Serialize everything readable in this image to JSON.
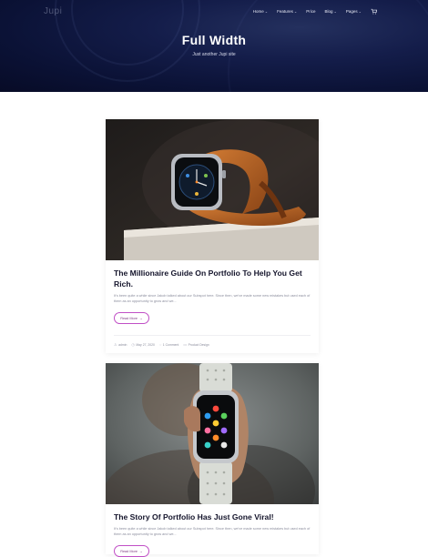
{
  "site": {
    "logo": "Jupi"
  },
  "nav": {
    "items": [
      {
        "label": "Home",
        "chevron": true
      },
      {
        "label": "Features",
        "chevron": true
      },
      {
        "label": "Price",
        "chevron": false
      },
      {
        "label": "Blog",
        "chevron": true
      },
      {
        "label": "Pages",
        "chevron": true
      }
    ],
    "cart_icon": "cart-icon"
  },
  "hero": {
    "title": "Full Width",
    "subtitle": "Just another Jupi site"
  },
  "posts": [
    {
      "title": "The Millionaire Guide On Portfolio To Help You Get Rich.",
      "excerpt": "It's been quite a while since Jakob talked about our Subspot here. Since then, we've made some new mistakes but used each of them as an opportunity to grow and we...",
      "read_more": "Read More",
      "meta": {
        "author": "admin",
        "date": "May 27, 2020",
        "comments": "1 Comment",
        "category": "Product Design"
      }
    },
    {
      "title": "The Story Of Portfolio Has Just Gone Viral!",
      "excerpt": "It's been quite a while since Jakob talked about our Subspot here. Since then, we've made some new mistakes but used each of them as an opportunity to grow and we...",
      "read_more": "Read More"
    }
  ],
  "colors": {
    "hero_bg": "#0b1236",
    "accent_border": "#c04fc6",
    "title_text": "#14142b"
  }
}
